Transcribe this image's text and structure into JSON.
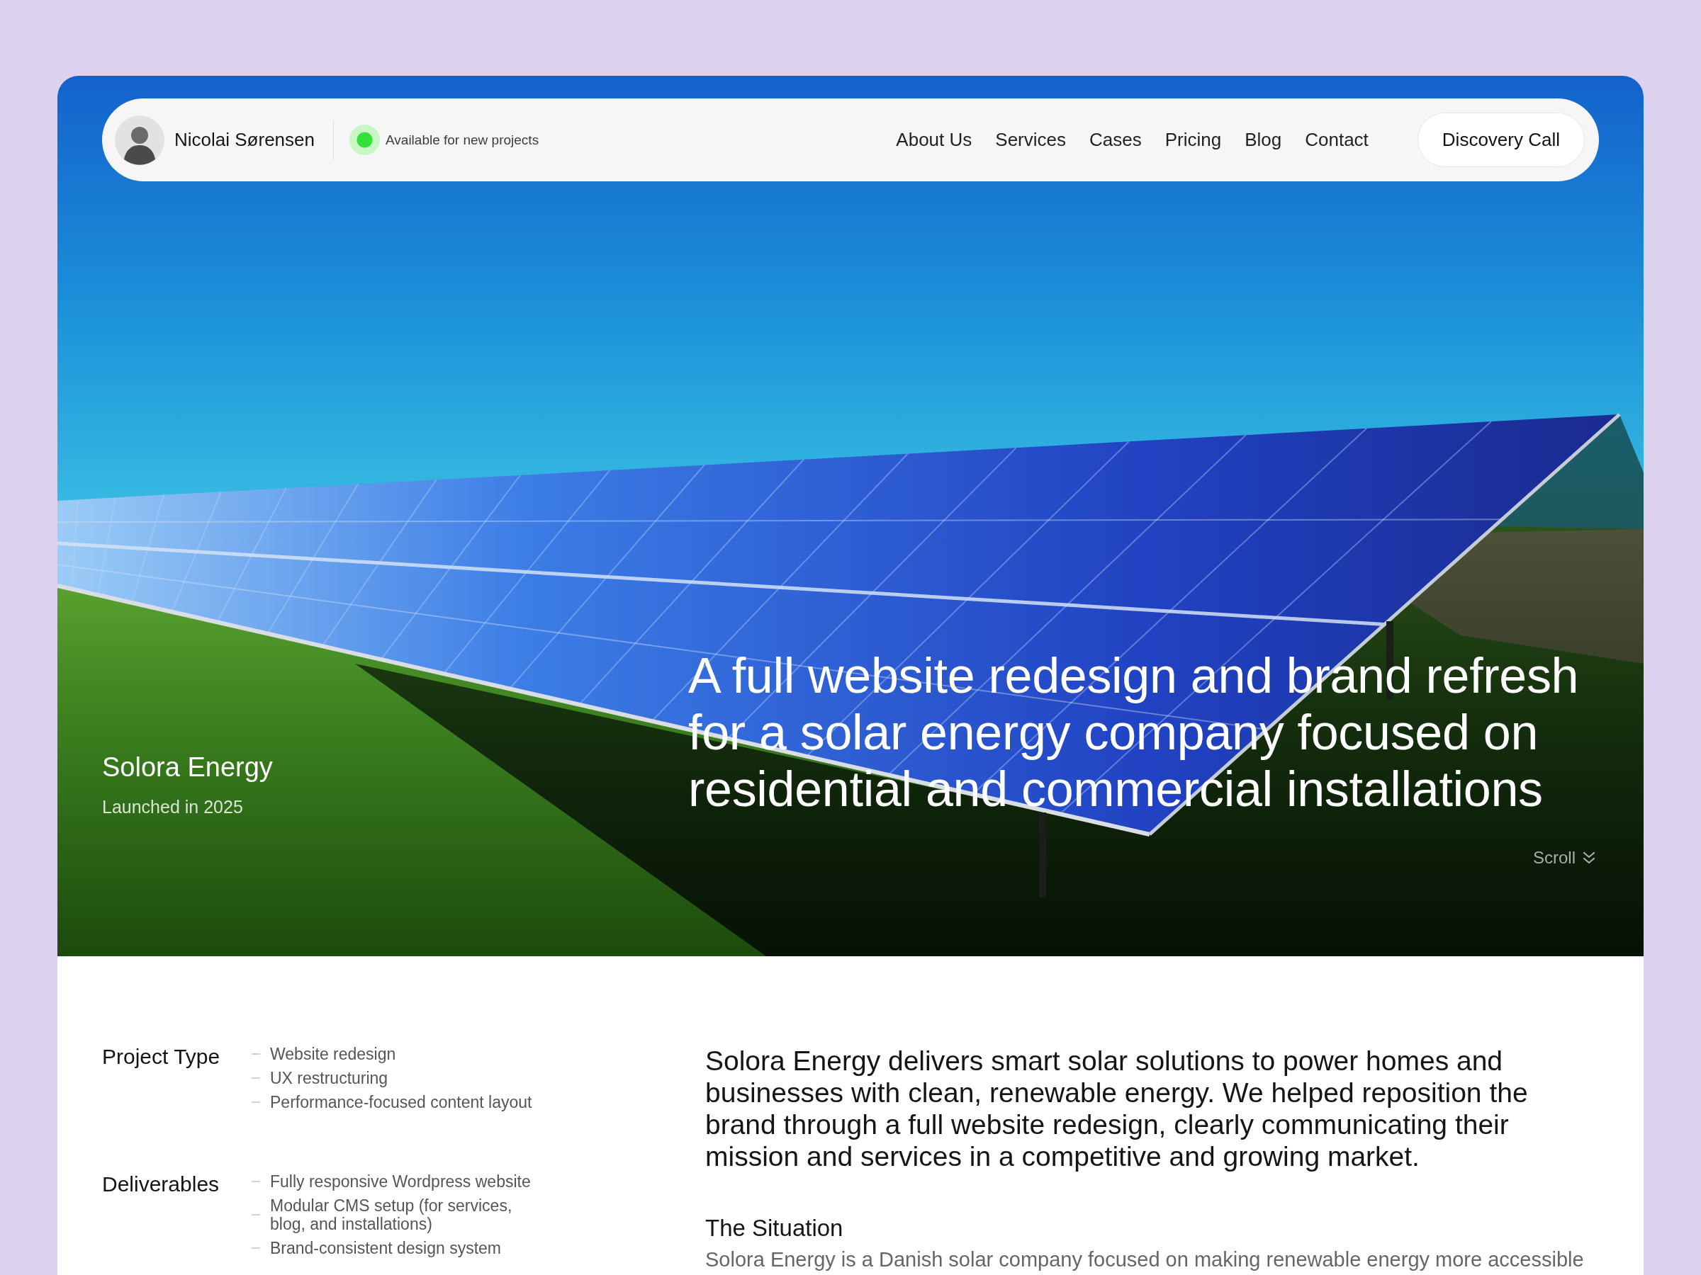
{
  "header": {
    "owner_name": "Nicolai Sørensen",
    "status": {
      "label": "Available for new projects",
      "available": true
    },
    "nav_links": [
      "About Us",
      "Services",
      "Cases",
      "Pricing",
      "Blog",
      "Contact"
    ],
    "cta_button": "Discovery Call"
  },
  "hero": {
    "project_name": "Solora Energy",
    "launch_note": "Launched in 2025",
    "headline": "A full website redesign and brand refresh for a solar energy company focused on residential and commercial installations",
    "scroll_hint": "Scroll"
  },
  "details": [
    {
      "label": "Project Type",
      "items": [
        "Website redesign",
        "UX restructuring",
        "Performance-focused content layout"
      ]
    },
    {
      "label": "Deliverables",
      "items": [
        "Fully responsive Wordpress website",
        "Modular CMS setup (for services, blog, and installations)",
        "Brand-consistent design system"
      ]
    }
  ],
  "overview": {
    "intro": "Solora Energy delivers smart solar solutions to power homes and businesses with clean, renewable energy. We helped reposition the brand through a full website redesign, clearly communicating their mission and services in a competitive and growing market.",
    "sections": [
      {
        "heading": "The Situation",
        "text": "Solora Energy is a Danish solar company focused on making renewable energy more accessible"
      }
    ]
  }
}
